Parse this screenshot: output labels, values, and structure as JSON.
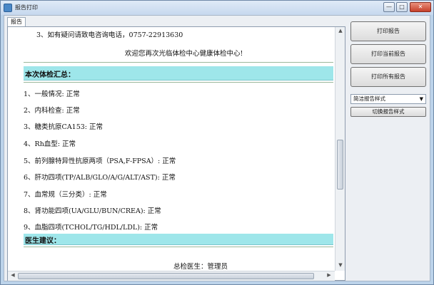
{
  "window": {
    "title": "报告打印"
  },
  "tabs": [
    {
      "label": "报告"
    }
  ],
  "report": {
    "intro_note": "3、如有疑问请致电咨询电话，0757-22913630",
    "welcome": "欢迎您再次光临体检中心健康体检中心!",
    "summary_header": "本次体检汇总：",
    "items": [
      "1、一般情况: 正常",
      "2、内科检查: 正常",
      "3、糖类抗原CA153: 正常",
      "4、Rh血型: 正常",
      "5、前列腺特异性抗原两项（PSA,F-FPSA）: 正常",
      "6、肝功四项(TP/ALB/GLO/A/G/ALT/AST): 正常",
      "7、血常规（三分类）: 正常",
      "8、肾功能四项(UA/GLU/BUN/CREA): 正常",
      "9、血脂四项(TCHOL/TG/HDL/LDL): 正常"
    ],
    "advice_header": "医生建议：",
    "doctor_line": "总检医生：管理员"
  },
  "actions": {
    "print_report": "打印报告",
    "print_current": "打印当前报告",
    "print_all": "打印所有报告",
    "style_select_value": "简洁报告样式",
    "switch_style": "切换报告样式"
  },
  "icons": {
    "app": "app-icon",
    "dropdown": "chevron-down-icon"
  }
}
